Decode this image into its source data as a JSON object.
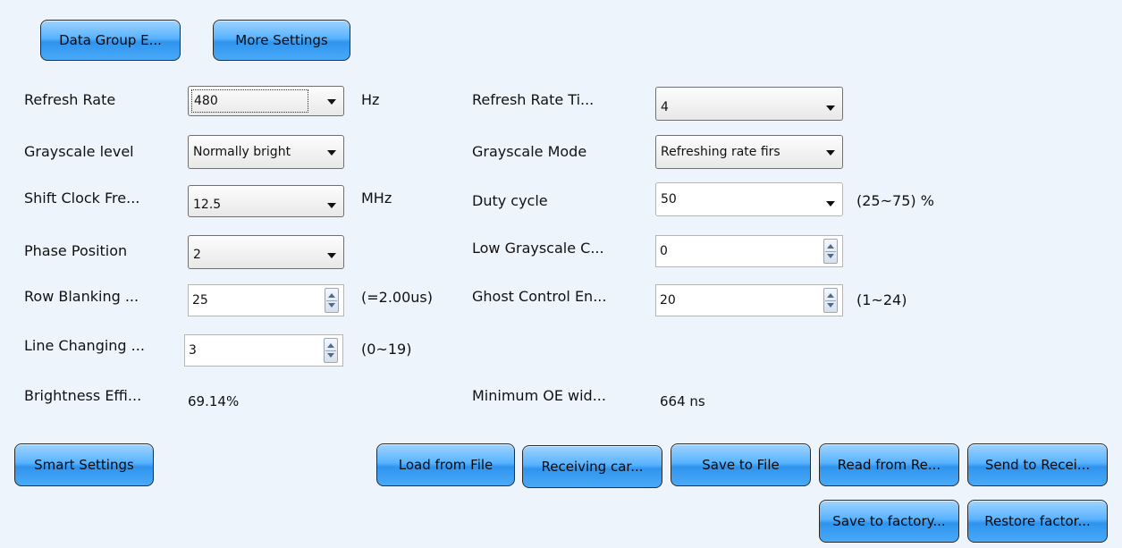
{
  "top_buttons": {
    "data_group": "Data Group E...",
    "more_settings": "More Settings"
  },
  "fields": {
    "refresh_rate": {
      "label": "Refresh Rate",
      "value": "480",
      "unit": "Hz"
    },
    "refresh_rate_times": {
      "label": "Refresh Rate Ti...",
      "value": "4"
    },
    "grayscale_level": {
      "label": "Grayscale level",
      "value": "Normally bright"
    },
    "grayscale_mode": {
      "label": "Grayscale Mode",
      "value": "Refreshing rate firs"
    },
    "shift_clock": {
      "label": "Shift Clock Fre...",
      "value": "12.5",
      "unit": "MHz"
    },
    "duty_cycle": {
      "label": "Duty cycle",
      "value": "50",
      "range": "(25~75) %"
    },
    "phase_position": {
      "label": "Phase Position",
      "value": "2"
    },
    "low_grayscale": {
      "label": "Low Grayscale C...",
      "value": "0"
    },
    "row_blanking": {
      "label": "Row Blanking ...",
      "value": "25",
      "note": "(=2.00us)"
    },
    "ghost_control": {
      "label": "Ghost Control En...",
      "value": "20",
      "range": "(1~24)"
    },
    "line_changing": {
      "label": "Line Changing ...",
      "value": "3",
      "range": "(0~19)"
    },
    "brightness_efficiency": {
      "label": "Brightness Effi...",
      "value": "69.14%"
    },
    "minimum_oe_width": {
      "label": "Minimum OE wid...",
      "value": "664 ns"
    }
  },
  "bottom_buttons": {
    "smart_settings": "Smart Settings",
    "load_from_file": "Load from File",
    "receiving_card": "Receiving car...",
    "save_to_file": "Save to File",
    "read_from": "Read from Re...",
    "send_to": "Send to Recei...",
    "save_to_factory": "Save to factory...",
    "restore_factory": "Restore factor..."
  }
}
